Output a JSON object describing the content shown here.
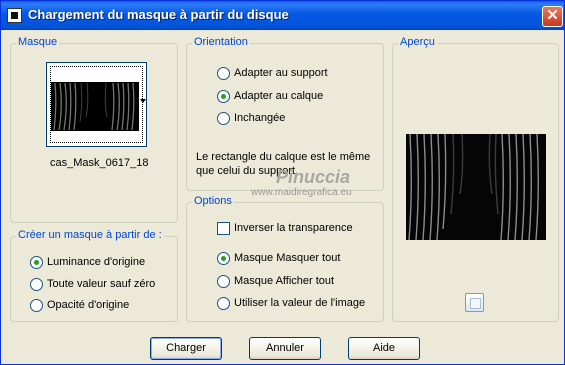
{
  "window": {
    "title": "Chargement du masque à partir du disque",
    "close_glyph": "✕"
  },
  "masque": {
    "legend": "Masque",
    "mask_name": "cas_Mask_0617_18"
  },
  "creer": {
    "legend": "Créer un masque à partir de :",
    "options": [
      {
        "label": "Luminance d'origine",
        "selected": true
      },
      {
        "label": "Toute valeur sauf zéro",
        "selected": false
      },
      {
        "label": "Opacité d'origine",
        "selected": false
      }
    ]
  },
  "orientation": {
    "legend": "Orientation",
    "options": [
      {
        "label": "Adapter au support",
        "selected": false
      },
      {
        "label": "Adapter au calque",
        "selected": true
      },
      {
        "label": "Inchangée",
        "selected": false
      }
    ],
    "note": "Le rectangle du calque est le même que celui du support."
  },
  "options": {
    "legend": "Options",
    "invert_label": "Inverser la transparence",
    "invert_checked": false,
    "items": [
      {
        "label": "Masque Masquer tout",
        "selected": true
      },
      {
        "label": "Masque Afficher tout",
        "selected": false
      },
      {
        "label": "Utiliser la valeur de l'image",
        "selected": false
      }
    ]
  },
  "apercu": {
    "legend": "Aperçu"
  },
  "buttons": {
    "charger": "Charger",
    "annuler": "Annuler",
    "aide": "Aide"
  },
  "watermark": {
    "line1": "Pinuccia",
    "line2": "www.maidiregrafica.eu"
  },
  "colors": {
    "titlebar": "#0458e4",
    "dialog_bg": "#ece9d8",
    "legend_text": "#0046d5",
    "radio_dot": "#21a121",
    "close_button": "#c4391c"
  }
}
